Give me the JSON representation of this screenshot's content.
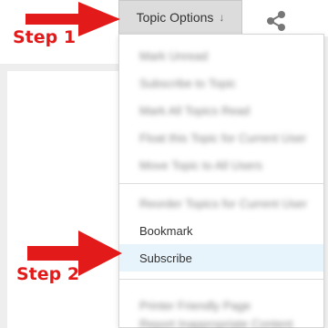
{
  "toolbar": {
    "topic_options_label": "Topic Options",
    "topic_options_arrow": "↓",
    "share_icon": "share-icon"
  },
  "menu": {
    "items": [
      {
        "label": "Mark Unread",
        "blurred": true
      },
      {
        "label": "Subscribe to Topic",
        "blurred": true
      },
      {
        "label": "Mark All Topics Read",
        "blurred": true
      },
      {
        "label": "Float this Topic for Current User",
        "blurred": true
      },
      {
        "label": "Move Topic to All Users",
        "blurred": true
      },
      {
        "label": "Reorder Topics for Current User",
        "blurred": true
      },
      {
        "label": "Bookmark",
        "blurred": false
      },
      {
        "label": "Subscribe",
        "blurred": false,
        "highlighted": true
      },
      {
        "label": "Printer Friendly Page",
        "blurred": true
      },
      {
        "label": "Report Inappropriate Content",
        "blurred": true
      }
    ]
  },
  "annotations": {
    "step1": "Step 1",
    "step2": "Step 2",
    "color": "#e31a1a"
  }
}
